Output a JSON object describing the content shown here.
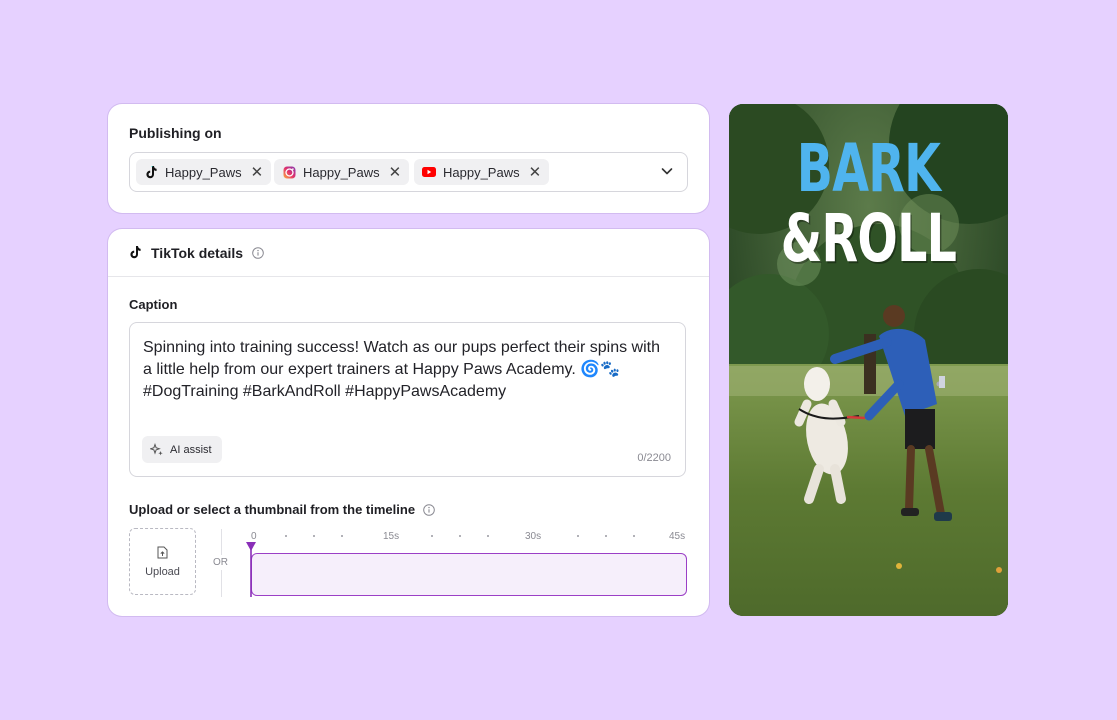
{
  "publishing": {
    "label": "Publishing on",
    "accounts": [
      {
        "platform": "tiktok",
        "icon": "tiktok-icon",
        "name": "Happy_Paws"
      },
      {
        "platform": "instagram",
        "icon": "instagram-icon",
        "name": "Happy_Paws"
      },
      {
        "platform": "youtube",
        "icon": "youtube-icon",
        "name": "Happy_Paws"
      }
    ]
  },
  "details": {
    "title": "TikTok details",
    "caption_label": "Caption",
    "caption_text": "Spinning into training success! Watch as our pups perfect their spins with a little help from our expert trainers at Happy Paws Academy. 🌀🐾 #DogTraining #BarkAndRoll #HappyPawsAcademy",
    "ai_assist": "AI assist",
    "counter": "0/2200",
    "thumbnail_label": "Upload or select a thumbnail from the timeline",
    "upload_label": "Upload",
    "or_label": "OR",
    "timeline_ticks": [
      "0",
      "15s",
      "30s",
      "45s"
    ]
  },
  "preview": {
    "line1": "BARK",
    "line2": "&ROLL"
  },
  "colors": {
    "background": "#e6d1ff",
    "accent": "#9b3fc6",
    "title_blue": "#4fb4ee",
    "youtube_red": "#ff0000"
  }
}
